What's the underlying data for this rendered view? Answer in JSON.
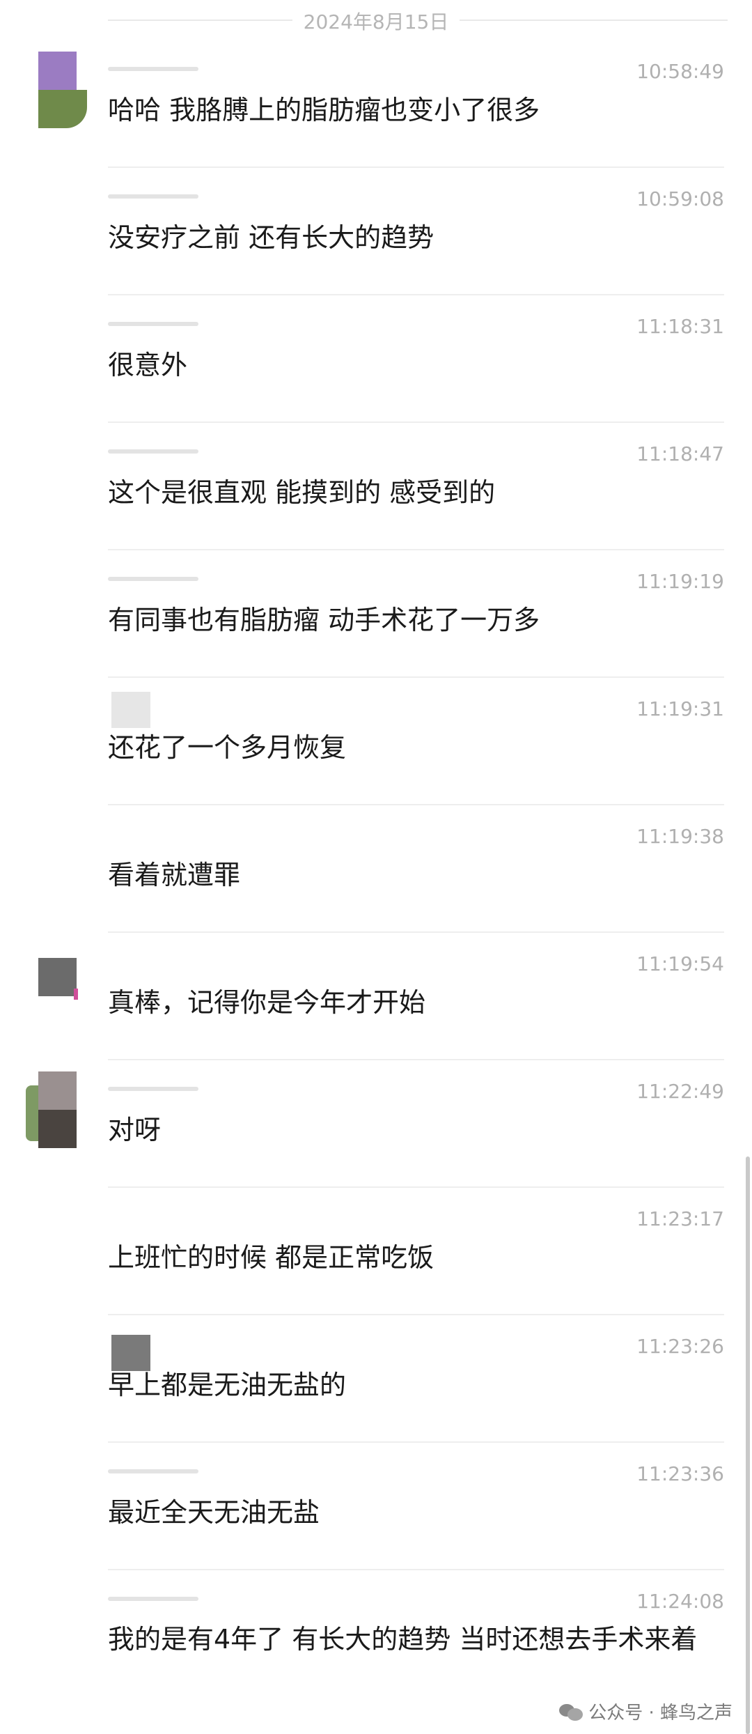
{
  "date_divider": "2024年8月15日",
  "messages": [
    {
      "time": "10:58:49",
      "text": "哈哈 我胳膊上的脂肪瘤也变小了很多"
    },
    {
      "time": "10:59:08",
      "text": "没安疗之前 还有长大的趋势"
    },
    {
      "time": "11:18:31",
      "text": "很意外"
    },
    {
      "time": "11:18:47",
      "text": "这个是很直观 能摸到的 感受到的"
    },
    {
      "time": "11:19:19",
      "text": "有同事也有脂肪瘤 动手术花了一万多"
    },
    {
      "time": "11:19:31",
      "text": "还花了一个多月恢复"
    },
    {
      "time": "11:19:38",
      "text": "看着就遭罪"
    },
    {
      "time": "11:19:54",
      "text": "真棒，记得你是今年才开始"
    },
    {
      "time": "11:22:49",
      "text": "对呀"
    },
    {
      "time": "11:23:17",
      "text": "上班忙的时候 都是正常吃饭"
    },
    {
      "time": "11:23:26",
      "text": "早上都是无油无盐的"
    },
    {
      "time": "11:23:36",
      "text": "最近全天无油无盐"
    },
    {
      "time": "11:24:08",
      "text": "我的是有4年了 有长大的趋势 当时还想去手术来着"
    }
  ],
  "watermark": "公众号 · 蜂鸟之声",
  "colors": {
    "avatar_purple": "#9b7cc2",
    "avatar_green": "#6f8a4a",
    "avatar_gray": "#6b6b6b"
  }
}
